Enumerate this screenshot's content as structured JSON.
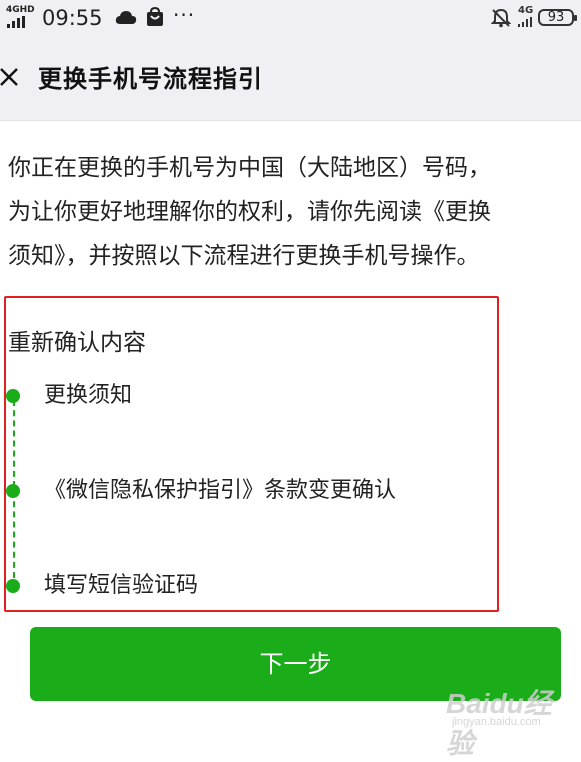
{
  "status_bar": {
    "network": "4GHD",
    "time": "09:55",
    "network2": "4G",
    "battery": "93",
    "icons": [
      "signal-icon",
      "cloud-icon",
      "shopping-bag-icon",
      "more-icon",
      "bell-muted-icon",
      "battery-icon"
    ]
  },
  "nav": {
    "title": "更换手机号流程指引",
    "close_icon": "close-icon"
  },
  "intro": {
    "lines": [
      "你正在更换的手机号为中国（大陆地区）号码，",
      "为让你更好地理解你的权利，请你先阅读《更换",
      "须知》，并按照以下流程进行更换手机号操作。"
    ]
  },
  "section": {
    "title": "重新确认内容",
    "steps": [
      {
        "label": "更换须知"
      },
      {
        "label": "《微信隐私保护指引》条款变更确认"
      },
      {
        "label": "填写短信验证码"
      }
    ]
  },
  "next_button": {
    "label": "下一步"
  },
  "watermark": {
    "logo": "Baidu经验",
    "url": "jingyan.baidu.com"
  },
  "colors": {
    "accent": "#1aad19",
    "highlight_border": "#e02020",
    "header_bg": "#efeff4"
  }
}
